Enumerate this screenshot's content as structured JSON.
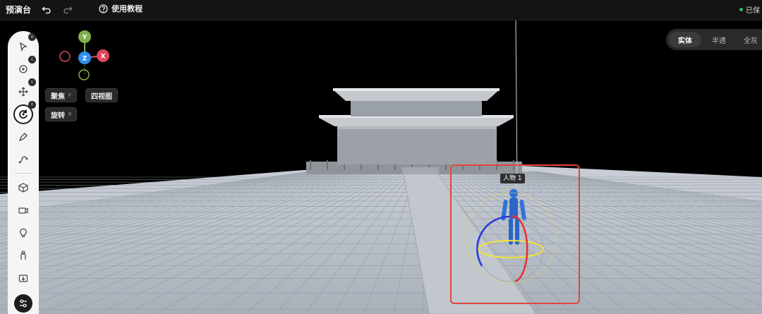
{
  "app": {
    "title": "预演台",
    "save_status": "已保",
    "status_color": "#22c55e"
  },
  "topbar": {
    "tutorial_label": "使用教程"
  },
  "toolbar": {
    "tools": [
      {
        "name": "select",
        "icon": "cursor-arrow-icon",
        "key": "W"
      },
      {
        "name": "orbit",
        "icon": "orbit-icon",
        "key": "G"
      },
      {
        "name": "move",
        "icon": "move-arrows-icon",
        "key": "G"
      },
      {
        "name": "rotate",
        "icon": "rotate-icon",
        "key": "R",
        "active": true
      },
      {
        "name": "pen",
        "icon": "pen-icon"
      },
      {
        "name": "path",
        "icon": "path-icon"
      },
      {
        "name": "cube",
        "icon": "cube-icon"
      },
      {
        "name": "camera",
        "icon": "camera-icon"
      },
      {
        "name": "light",
        "icon": "light-bulb-icon"
      },
      {
        "name": "character",
        "icon": "person-icon"
      },
      {
        "name": "import",
        "icon": "import-icon"
      },
      {
        "name": "settings",
        "icon": "sliders-icon"
      }
    ]
  },
  "gizmo": {
    "y": "Y",
    "z": "Z",
    "x": "X",
    "colors": {
      "y": "#7fb24a",
      "z": "#2f8ff0",
      "x": "#e0465a"
    }
  },
  "view_controls": {
    "focus_label": "聚焦",
    "focus_key": "F",
    "quad_view_label": "四视图",
    "rotate_label": "旋转",
    "rotate_key": "R"
  },
  "render_modes": {
    "items": [
      "实体",
      "半透",
      "全灰"
    ],
    "active": "实体"
  },
  "scene": {
    "selected_object_label": "人物 1",
    "selection_color": "#e1453a"
  }
}
